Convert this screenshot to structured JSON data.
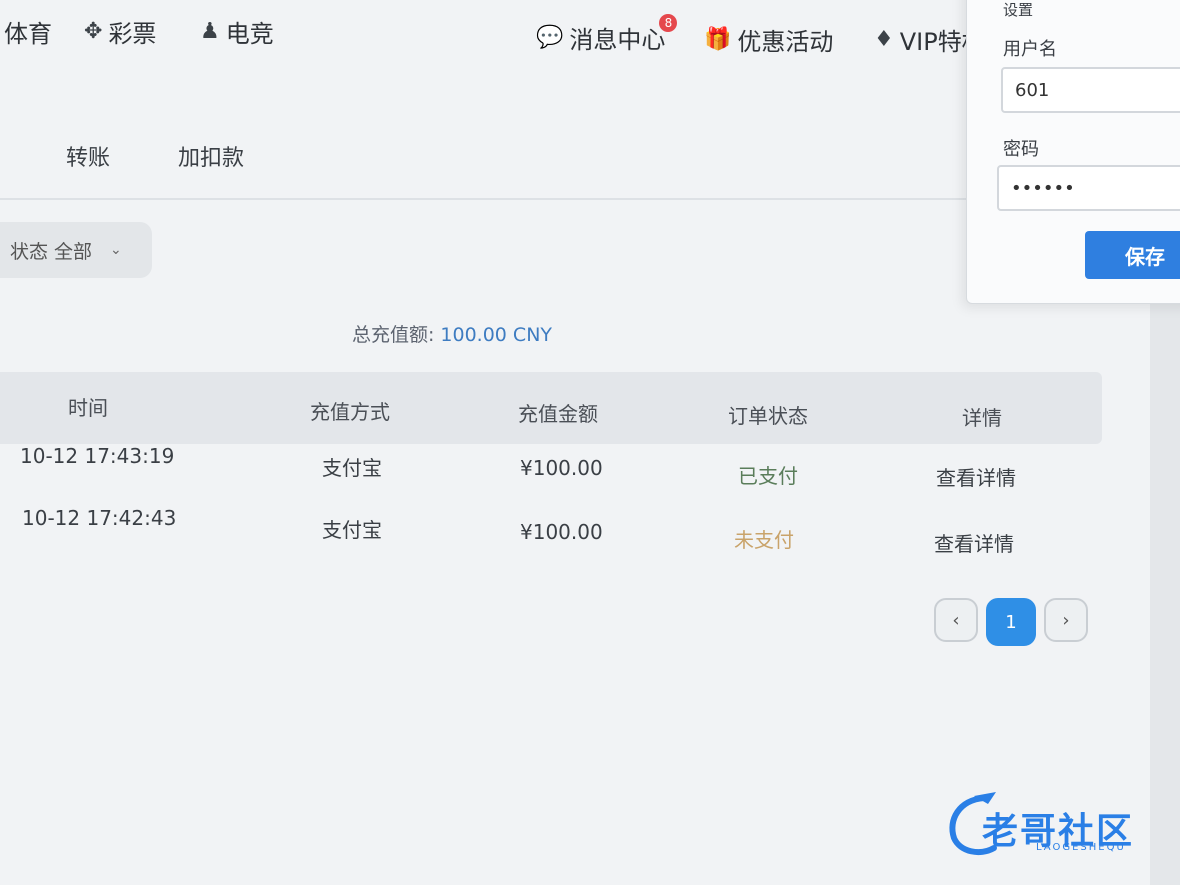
{
  "nav": {
    "left": [
      {
        "label": "体育",
        "icon": "sports-icon"
      },
      {
        "label": "彩票",
        "icon": "lottery-icon"
      },
      {
        "label": "电竞",
        "icon": "esports-icon"
      }
    ],
    "right": [
      {
        "label": "消息中心",
        "icon": "message-icon",
        "badge": "8"
      },
      {
        "label": "优惠活动",
        "icon": "gift-icon"
      },
      {
        "label": "VIP特权",
        "icon": "diamond-icon"
      }
    ]
  },
  "tabs": [
    "转账",
    "加扣款"
  ],
  "filter": {
    "label": "状态",
    "value": "全部"
  },
  "summary": {
    "label": "总充值额:",
    "amount": "100.00 CNY"
  },
  "table": {
    "headers": [
      "时间",
      "充值方式",
      "充值金额",
      "订单状态",
      "详情"
    ],
    "rows": [
      {
        "time": "10-12 17:43:19",
        "method": "支付宝",
        "amount": "¥100.00",
        "status": "已支付",
        "detail": "查看详情"
      },
      {
        "time": "10-12 17:42:43",
        "method": "支付宝",
        "amount": "¥100.00",
        "status": "未支付",
        "detail": "查看详情"
      }
    ]
  },
  "pagination": {
    "prev": "‹",
    "page": "1",
    "next": "›"
  },
  "popover": {
    "title": "设置",
    "username_label": "用户名",
    "username_value": "601",
    "password_label": "密码",
    "password_value": "••••••",
    "save_label": "保存"
  },
  "watermark": {
    "text": "老哥社区",
    "sub": "LAOGESHEQU"
  },
  "colors": {
    "accent": "#2f8fe6",
    "paid": "#5a7d5a",
    "unpaid": "#c9a36a",
    "amount": "#3e7cc1"
  }
}
